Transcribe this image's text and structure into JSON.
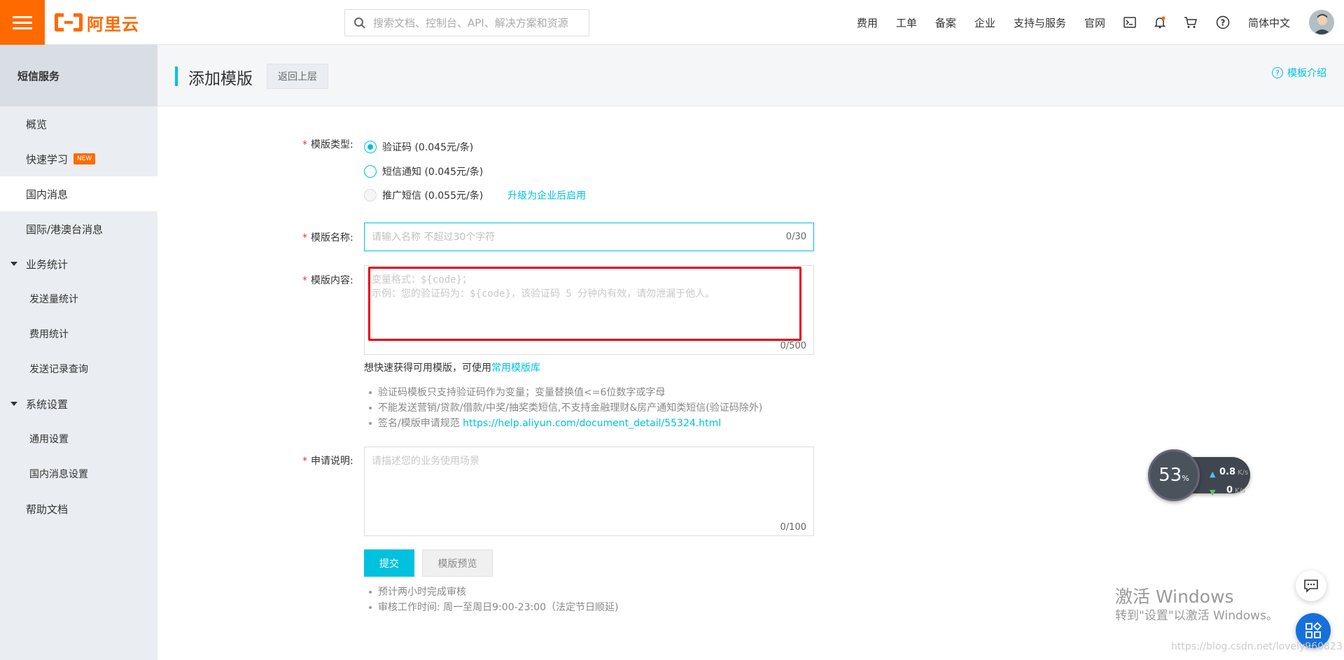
{
  "topbar": {
    "logo_text": "阿里云",
    "search_placeholder": "搜索文档、控制台、API、解决方案和资源",
    "nav": [
      "费用",
      "工单",
      "备案",
      "企业",
      "支持与服务",
      "官网"
    ],
    "language": "简体中文"
  },
  "sidebar": {
    "title": "短信服务",
    "items": {
      "overview": "概览",
      "quick_learn": "快速学习",
      "new_badge": "NEW",
      "domestic": "国内消息",
      "international": "国际/港澳台消息",
      "stats_group": "业务统计",
      "send_stats": "发送量统计",
      "cost_stats": "费用统计",
      "send_records": "发送记录查询",
      "settings_group": "系统设置",
      "general_settings": "通用设置",
      "domestic_settings": "国内消息设置",
      "help_docs": "帮助文档"
    }
  },
  "header": {
    "title": "添加模版",
    "back_label": "返回上层",
    "intro_label": "模板介绍"
  },
  "form": {
    "type_label": "模版类型:",
    "type_options": {
      "verify": "验证码 (0.045元/条)",
      "notice": "短信通知 (0.045元/条)",
      "promo": "推广短信 (0.055元/条)"
    },
    "selected_type": "验证码 (0.045元/条)",
    "upgrade_link": "升级为企业后启用",
    "name_label": "模版名称:",
    "name_placeholder": "请输入名称 不超过30个字符",
    "name_counter": "0/30",
    "content_label": "模版内容:",
    "content_placeholder": "变量格式：${code}；\n示例：您的验证码为：${code}，该验证码 5 分钟内有效，请勿泄漏于他人。",
    "content_counter": "0/500",
    "template_hint_prefix": "想快速获得可用模版，可使用",
    "template_hint_link": "常用模版库",
    "rules": {
      "rule1": "验证码模板只支持验证码作为变量；变量替换值<=6位数字或字母",
      "rule2": "不能发送营销/贷款/借款/中奖/抽奖类短信,不支持金融理财&房产通知类短信(验证码除外)",
      "rule3_prefix": "签名/模版申请规范 ",
      "rule3_link": "https://help.aliyun.com/document_detail/55324.html"
    },
    "desc_label": "申请说明:",
    "desc_placeholder": "请描述您的业务使用场景",
    "desc_counter": "0/100",
    "submit_label": "提交",
    "preview_label": "模版预览",
    "review_notes": {
      "note1": "预计两小时完成审核",
      "note2": "审核工作时间: 周一至周日9:00-23:00（法定节日顺延)"
    }
  },
  "speed_widget": {
    "percent": "53",
    "percent_unit": "%",
    "up_value": "0.8",
    "down_value": "0",
    "unit": "K/s"
  },
  "watermark": {
    "line1": "激活 Windows",
    "line2": "转到\"设置\"以激活 Windows。",
    "csdn": "https://blog.csdn.net/lovely960823"
  },
  "colors": {
    "brand_orange": "#ff6a00",
    "accent_cyan": "#00c1de",
    "highlight_red": "#e60012"
  }
}
